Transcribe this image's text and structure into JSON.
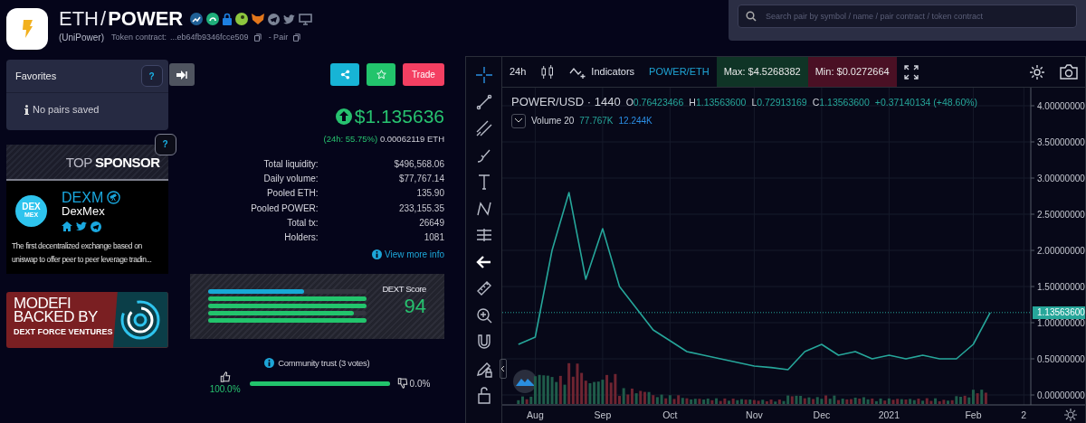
{
  "header": {
    "base": "ETH",
    "separator": "/",
    "quote": "POWER",
    "token_name": "(UniPower)",
    "contract_label": "Token contract:",
    "contract": "...eb64fb9346fcce509",
    "pair_label": "- Pair"
  },
  "search": {
    "placeholder": "Search pair by symbol / name / pair contract / token contract"
  },
  "favorites": {
    "title": "Favorites",
    "help": "?",
    "empty_text": "No pairs saved"
  },
  "sponsor": {
    "help": "?",
    "heading": "TOP **SPONSOR**",
    "logo_text": [
      "DEX",
      "MEX"
    ],
    "symbol": "DEXM",
    "name": "DexMex",
    "description": "The first decentralized exchange based on uniswap to offer peer to peer leverage tradin..."
  },
  "banner": {
    "line1": "MODEFI",
    "line2": "BACKED BY",
    "line3": "DEXT FORCE VENTURES"
  },
  "actions": [
    {
      "kind": "share"
    },
    {
      "kind": "favorite"
    },
    {
      "kind": "trade",
      "label": "Trade"
    }
  ],
  "price": {
    "usd": "$1.135636",
    "change": "(24h: 55.75%)",
    "eth": "0.00062119 ETH"
  },
  "stats": [
    {
      "label": "Total liquidity:",
      "value": "$496,568.06"
    },
    {
      "label": "Daily volume:",
      "value": "$77,767.14"
    },
    {
      "label": "Pooled ETH:",
      "value": "135.90"
    },
    {
      "label": "Pooled POWER:",
      "value": "233,155.35"
    },
    {
      "label": "Total tx:",
      "value": "26649"
    },
    {
      "label": "Holders:",
      "value": "1081"
    }
  ],
  "more_info": "View more info",
  "score": {
    "title": "DEXT Score",
    "value": "94",
    "bars": [
      {
        "level": 0.61,
        "color": "#17a8d6"
      },
      {
        "level": 1.0,
        "color": "#22c46c"
      },
      {
        "level": 1.0,
        "color": "#22c46c"
      },
      {
        "level": 0.92,
        "color": "#22c46c"
      },
      {
        "level": 1.0,
        "color": "#22c46c"
      }
    ]
  },
  "community": {
    "title": "Community trust (3 votes)",
    "up": "100.0%",
    "down": "0.0%",
    "level": 1.0
  },
  "chart": {
    "toolbar": {
      "interval": "24h",
      "indicators": "Indicators",
      "pair": "POWER/ETH",
      "max": "Max: $4.5268382",
      "min": "Min: $0.0272664"
    },
    "tools": [
      {
        "kind": "crosshair",
        "selected": true
      },
      {
        "kind": "line",
        "selected": false
      },
      {
        "kind": "parallel",
        "selected": false
      },
      {
        "kind": "brush",
        "selected": false
      },
      {
        "kind": "text",
        "selected": false
      },
      {
        "kind": "pattern",
        "selected": false
      },
      {
        "kind": "measure",
        "selected": false
      },
      {
        "kind": "back",
        "selected": false
      },
      {
        "kind": "ruler",
        "selected": false
      },
      {
        "kind": "zoom",
        "selected": false
      },
      {
        "kind": "magnet",
        "selected": false
      },
      {
        "kind": "pencil-lock",
        "selected": false
      },
      {
        "kind": "lock",
        "selected": false
      }
    ],
    "symbol": "POWER/USD · 1440",
    "ohlc": [
      {
        "key": "O",
        "value": "0.76423466"
      },
      {
        "key": "H",
        "value": "1.13563600"
      },
      {
        "key": "L",
        "value": "0.72913169"
      },
      {
        "key": "C",
        "value": "1.13563600"
      }
    ],
    "change": "+0.37140134 (+48.60%)",
    "volume": {
      "label": "Volume 20",
      "value1": "77.767K",
      "value2": "12.244K"
    },
    "last_price": "1.13563600",
    "chart_data": {
      "type": "line",
      "categories": [
        null,
        "Aug",
        null,
        null,
        null,
        "Sep",
        null,
        null,
        null,
        "Oct",
        null,
        null,
        null,
        null,
        "Nov",
        null,
        null,
        null,
        "Dec",
        null,
        null,
        null,
        "2021",
        null,
        null,
        null,
        null,
        "Feb",
        null,
        null,
        "2"
      ],
      "series": [
        {
          "color": "#26a69a",
          "values": [
            0.7,
            0.8,
            2.0,
            2.8,
            1.6,
            2.3,
            1.5,
            1.2,
            0.9,
            0.75,
            0.6,
            0.55,
            0.5,
            0.45,
            0.4,
            0.38,
            0.35,
            0.6,
            0.7,
            0.55,
            0.6,
            0.5,
            0.55,
            0.5,
            0.55,
            0.5,
            0.5,
            0.7,
            1.14,
            null,
            null
          ]
        }
      ],
      "grid": true,
      "ylim": [
        -0.1375,
        4.25
      ],
      "yticks": [
        {
          "value": 0,
          "label": "0.00000000"
        },
        {
          "value": 0.5,
          "label": "0.50000000"
        },
        {
          "value": 1,
          "label": "1.00000000"
        },
        {
          "value": 1.5,
          "label": "1.50000000"
        },
        {
          "value": 2,
          "label": "2.00000000"
        },
        {
          "value": 2.5,
          "label": "2.50000000"
        },
        {
          "value": 3,
          "label": "3.00000000"
        },
        {
          "value": 3.5,
          "label": "3.50000000"
        },
        {
          "value": 4,
          "label": "4.00000000"
        }
      ]
    }
  }
}
